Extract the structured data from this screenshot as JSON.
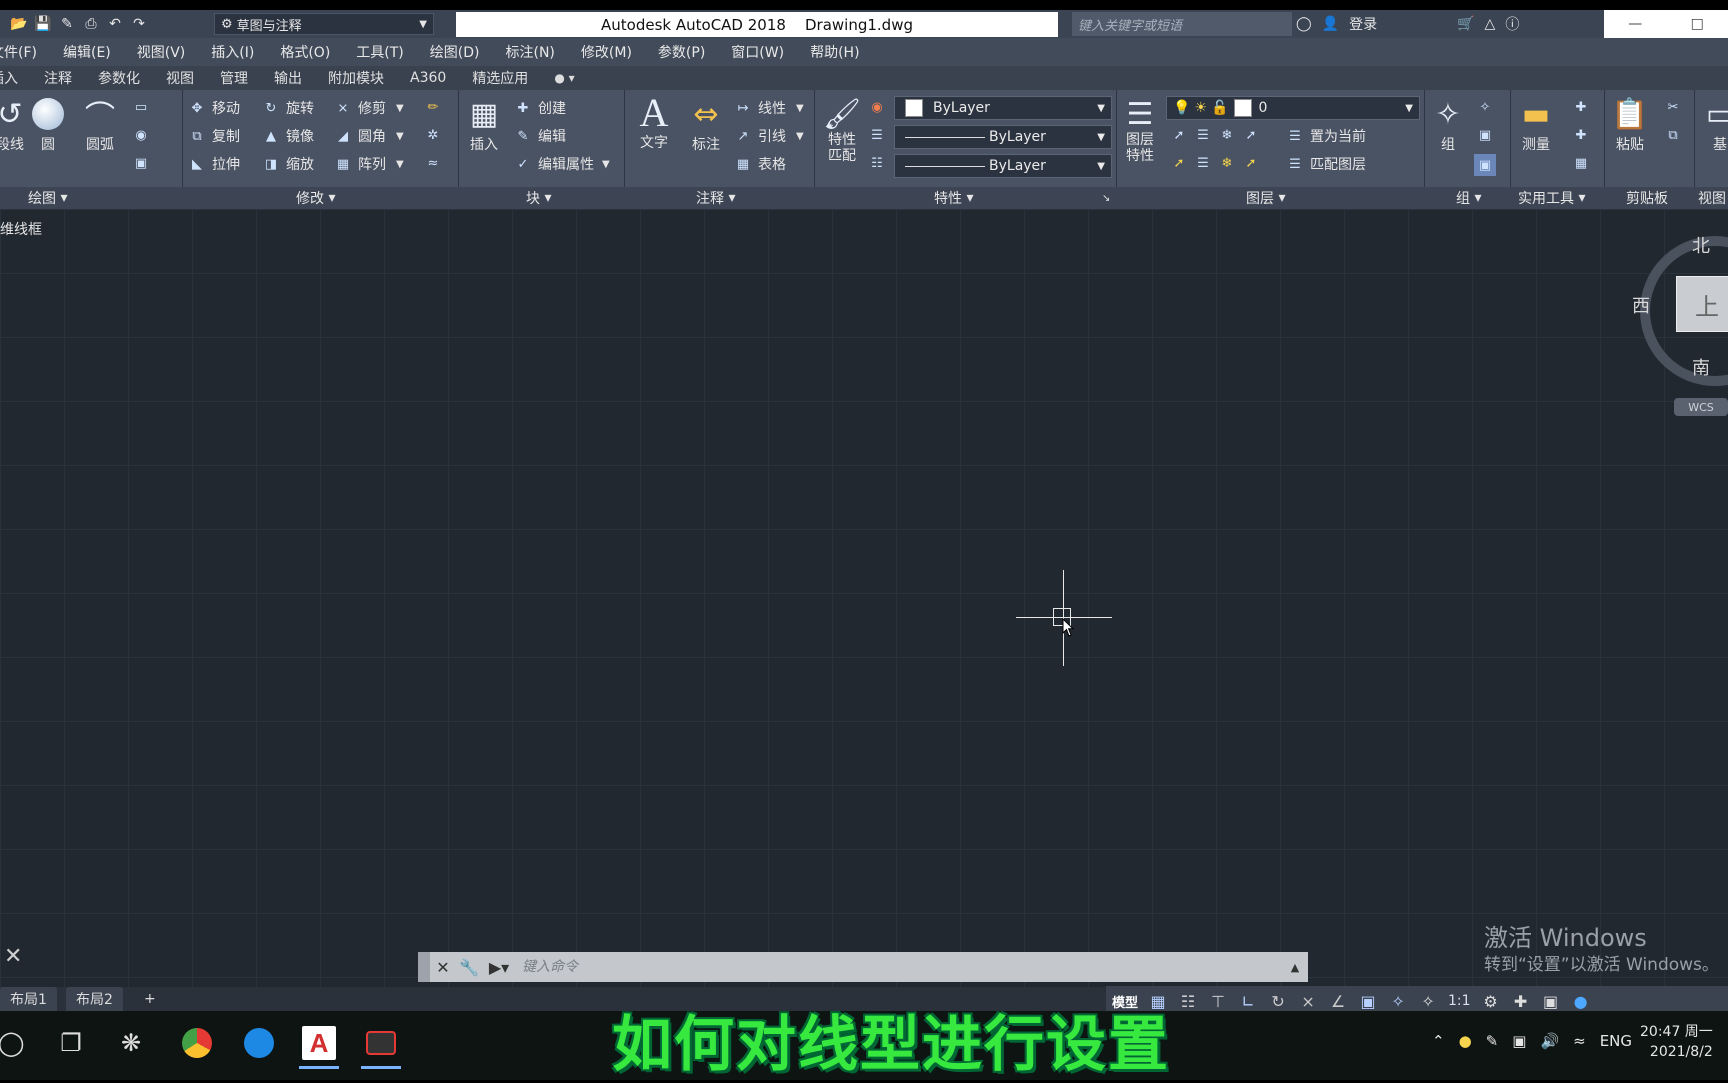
{
  "titlebar": {
    "workspace": "草图与注释",
    "title": "Autodesk AutoCAD 2018    Drawing1.dwg",
    "search_placeholder": "键入关键字或短语",
    "login": "登录"
  },
  "menu": [
    "文件(F)",
    "编辑(E)",
    "视图(V)",
    "插入(I)",
    "格式(O)",
    "工具(T)",
    "绘图(D)",
    "标注(N)",
    "修改(M)",
    "参数(P)",
    "窗口(W)",
    "帮助(H)"
  ],
  "ribbon_tabs": [
    "插入",
    "注释",
    "参数化",
    "视图",
    "管理",
    "输出",
    "附加模块",
    "A360",
    "精选应用"
  ],
  "ribbon": {
    "draw": {
      "polyline": "段线",
      "circle": "圆",
      "arc": "圆弧",
      "panel": "绘图"
    },
    "modify": {
      "move": "移动",
      "rotate": "旋转",
      "trim": "修剪",
      "copy": "复制",
      "mirror": "镜像",
      "fillet": "圆角",
      "stretch": "拉伸",
      "scale": "缩放",
      "array": "阵列",
      "panel": "修改"
    },
    "block": {
      "insert": "插入",
      "create": "创建",
      "edit": "编辑",
      "edit_attr": "编辑属性",
      "panel": "块"
    },
    "annotation": {
      "text": "文字",
      "dimension": "标注",
      "linear": "线性",
      "leader": "引线",
      "table": "表格",
      "panel": "注释"
    },
    "properties": {
      "match": "特性",
      "match2": "匹配",
      "color": "ByLayer",
      "linetype": "ByLayer",
      "lineweight": "ByLayer",
      "panel": "特性"
    },
    "layers": {
      "props": "图层",
      "props2": "特性",
      "layer_value": "0",
      "set_current": "置为当前",
      "match_layer": "匹配图层",
      "panel": "图层"
    },
    "groups": {
      "group": "组",
      "panel": "组"
    },
    "utilities": {
      "measure": "测量",
      "panel": "实用工具"
    },
    "clipboard": {
      "paste": "粘贴",
      "panel": "剪贴板"
    },
    "view_panel": {
      "partial": "基",
      "panel": "视图"
    }
  },
  "canvas": {
    "view_label": "二维线框"
  },
  "viewcube": {
    "north": "北",
    "west": "西",
    "south": "南",
    "top": "上",
    "wcs": "WCS"
  },
  "command": {
    "placeholder": "键入命令"
  },
  "layout_tabs": [
    "布局1",
    "布局2",
    "+"
  ],
  "status": {
    "model": "模型",
    "scale": "1:1"
  },
  "activation": {
    "title": "激活 Windows",
    "subtitle": "转到“设置”以激活 Windows。"
  },
  "caption": "如何对线型进行设置",
  "tray": {
    "lang": "ENG",
    "time": "20:47 周一",
    "date": "2021/8/2"
  },
  "colors": {
    "canvas": "#212830",
    "ribbon": "#4a5363",
    "caption": "#37e83f"
  }
}
